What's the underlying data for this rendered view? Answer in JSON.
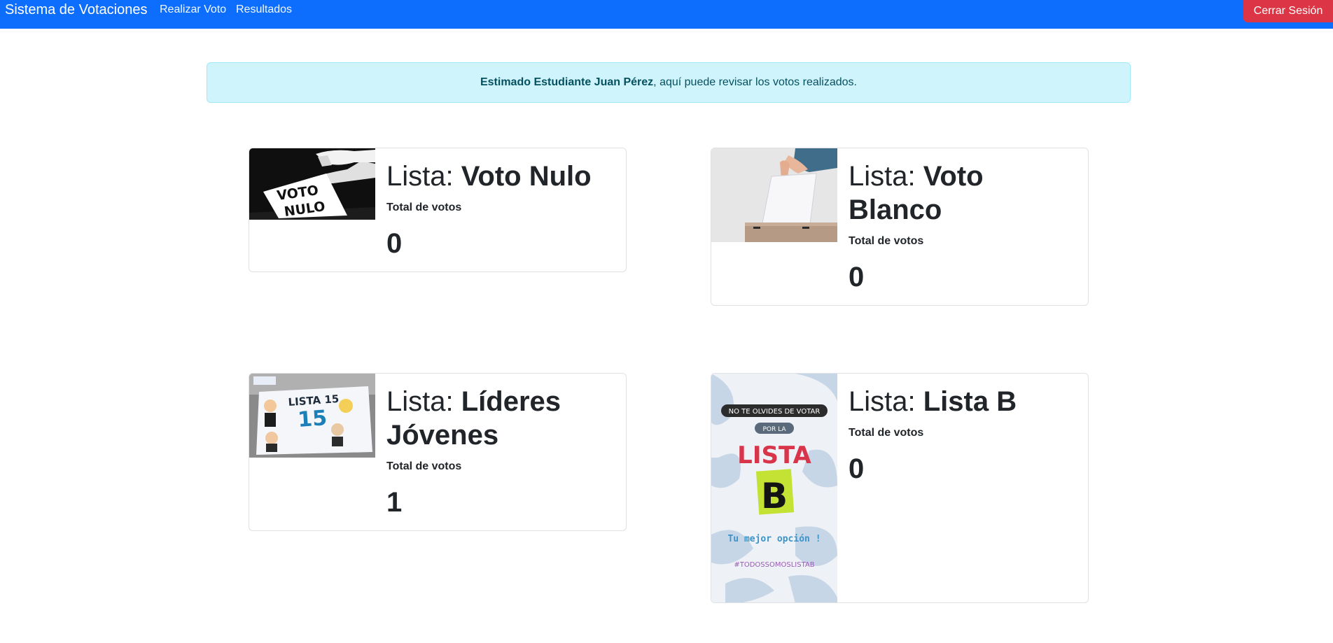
{
  "navbar": {
    "brand": "Sistema de Votaciones",
    "links": [
      "Realizar Voto",
      "Resultados"
    ],
    "logout_label": "Cerrar Sesión",
    "bg_color": "#0d6efd",
    "logout_color": "#dc3545"
  },
  "alert": {
    "bold_text": "Estimado Estudiante Juan Pérez",
    "text": ", aquí puede revisar los votos realizados."
  },
  "cards": [
    {
      "prefix": "Lista: ",
      "name": "Voto Nulo",
      "subtitle": "Total de votos",
      "votes": "0",
      "image": {
        "text": [
          "VOTO",
          "NULO"
        ]
      }
    },
    {
      "prefix": "Lista: ",
      "name": "Voto Blanco",
      "subtitle": "Total de votos",
      "votes": "0"
    },
    {
      "prefix": "Lista: ",
      "name": "Líderes Jóvenes",
      "subtitle": "Total de votos",
      "votes": "1",
      "image": {
        "text": [
          "LISTA 15",
          "15"
        ]
      }
    },
    {
      "prefix": "Lista: ",
      "name": "Lista B",
      "subtitle": "Total de votos",
      "votes": "0",
      "image": {
        "text": [
          "NO TE OLVIDES DE VOTAR",
          "POR LA",
          "LISTA",
          "B",
          "Tu mejor opción !",
          "#TODOSSOMOSLISTAB"
        ]
      }
    }
  ]
}
